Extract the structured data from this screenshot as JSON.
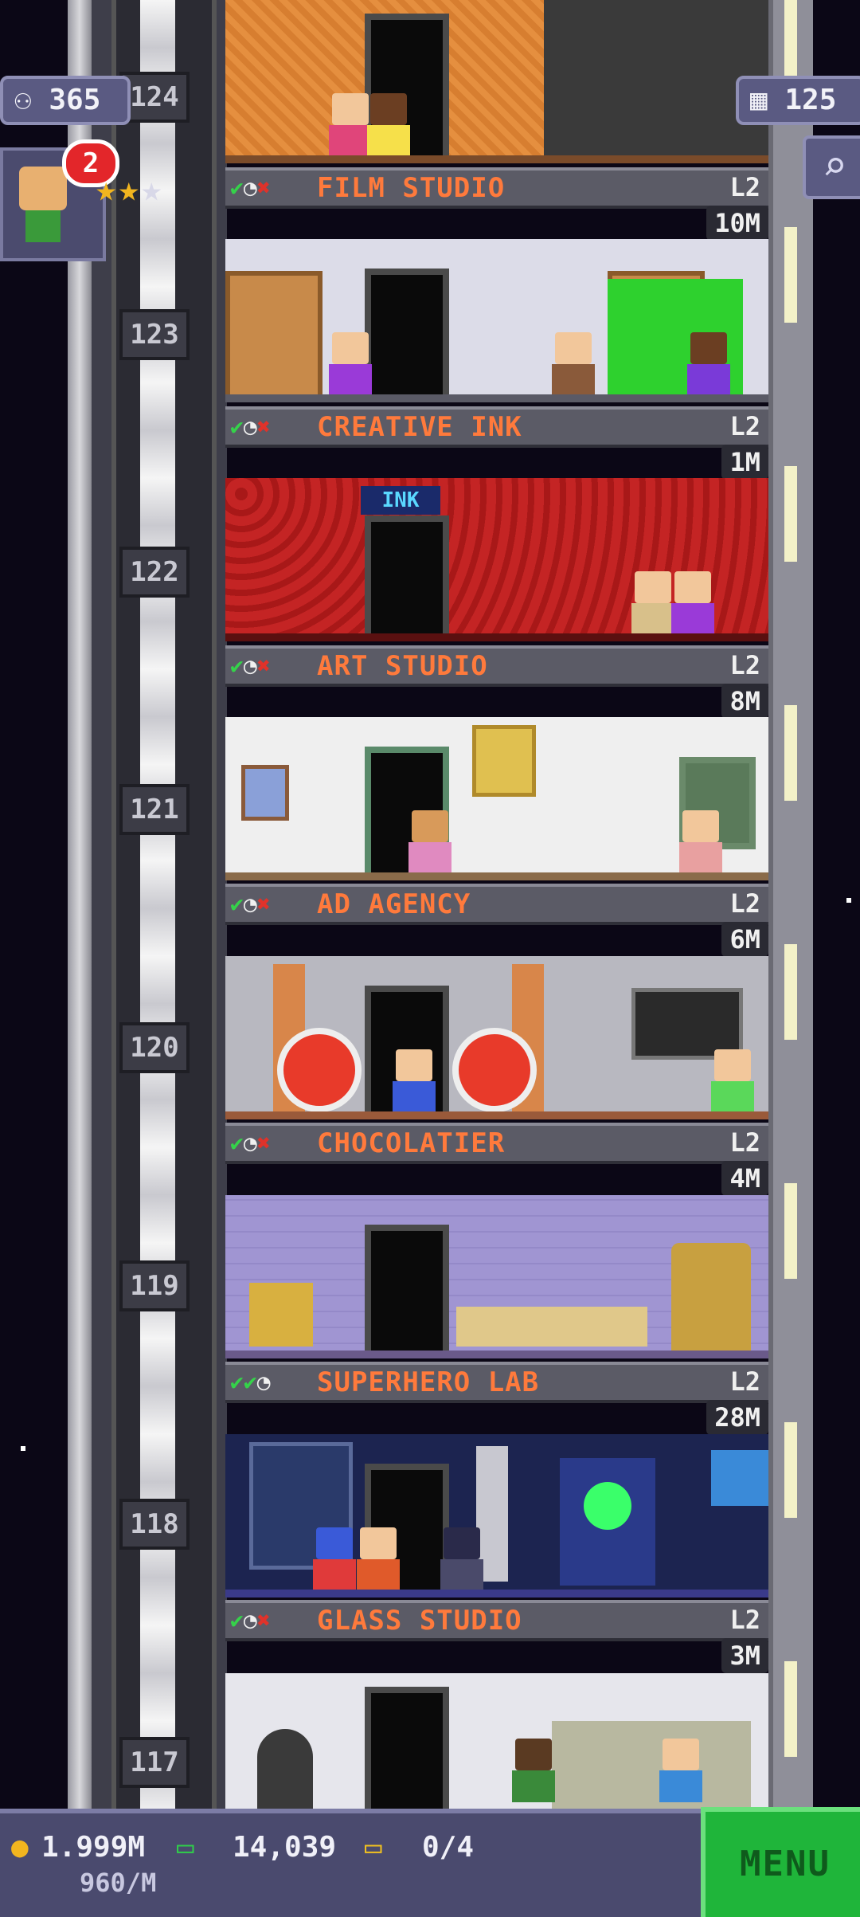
{
  "hud": {
    "population": "365",
    "floors": "125",
    "notification_count": "2",
    "top_floor_number": "124"
  },
  "floors": [
    {
      "number": "123",
      "name": "FILM STUDIO",
      "level": "L2",
      "price": "10M"
    },
    {
      "number": "122",
      "name": "CREATIVE INK",
      "level": "L2",
      "price": "1M"
    },
    {
      "number": "121",
      "name": "ART STUDIO",
      "level": "L2",
      "price": "8M"
    },
    {
      "number": "120",
      "name": "AD AGENCY",
      "level": "L2",
      "price": "6M"
    },
    {
      "number": "119",
      "name": "CHOCOLATIER",
      "level": "L2",
      "price": "4M"
    },
    {
      "number": "118",
      "name": "SUPERHERO LAB",
      "level": "L2",
      "price": "28M"
    },
    {
      "number": "117",
      "name": "GLASS STUDIO",
      "level": "L2",
      "price": "3M"
    }
  ],
  "bottom": {
    "coins": "1.999M",
    "coins_rate": "960/M",
    "bux": "14,039",
    "tickets": "0/4",
    "menu_label": "MENU"
  },
  "colors": {
    "label_text": "#ff7a3c",
    "menu_green": "#1fb53a",
    "hud_purple": "#5a5a82"
  }
}
